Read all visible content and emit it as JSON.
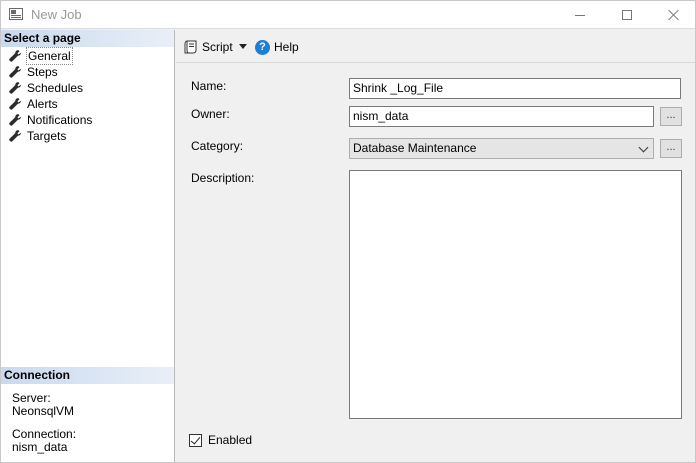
{
  "window": {
    "title": "New Job",
    "controls": {
      "minimize_icon": "minimize-icon",
      "maximize_icon": "maximize-icon",
      "close_icon": "close-icon"
    }
  },
  "sidebar": {
    "header": "Select a page",
    "items": [
      {
        "label": "General",
        "icon": "wrench-icon",
        "selected": true
      },
      {
        "label": "Steps",
        "icon": "wrench-icon"
      },
      {
        "label": "Schedules",
        "icon": "wrench-icon"
      },
      {
        "label": "Alerts",
        "icon": "wrench-icon"
      },
      {
        "label": "Notifications",
        "icon": "wrench-icon"
      },
      {
        "label": "Targets",
        "icon": "wrench-icon"
      }
    ],
    "connection": {
      "header": "Connection",
      "server_label": "Server:",
      "server_value": "NeonsqlVM",
      "connection_label": "Connection:",
      "connection_value": "nism_data"
    }
  },
  "toolbar": {
    "script_label": "Script",
    "help_label": "Help"
  },
  "form": {
    "name_label": "Name:",
    "name_value": "Shrink _Log_File",
    "owner_label": "Owner:",
    "owner_value": "nism_data",
    "category_label": "Category:",
    "category_value": "Database Maintenance",
    "description_label": "Description:",
    "description_value": "",
    "browse_label": "...",
    "enabled_label": "Enabled",
    "enabled_checked": true
  },
  "colors": {
    "section_header": "#c9d9ee",
    "help_icon": "#1d7fd3",
    "title_text": "#999999"
  }
}
